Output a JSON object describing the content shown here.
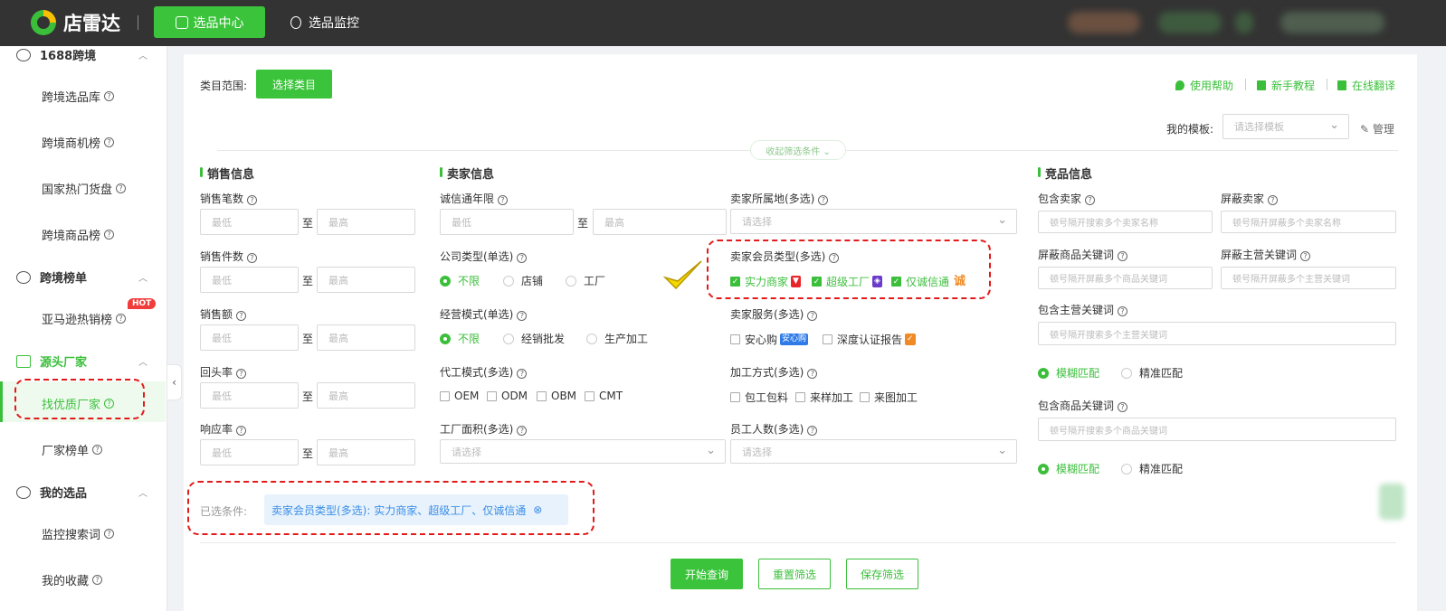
{
  "app": {
    "title": "店雷达"
  },
  "topnav": {
    "active_tab": "选品中心",
    "tab2": "选品监控"
  },
  "sidebar": {
    "sec1": "1688跨境",
    "sec1_items": [
      "跨境选品库",
      "跨境商机榜",
      "国家热门货盘",
      "跨境商品榜"
    ],
    "sec2": "跨境榜单",
    "sec2_items": [
      "亚马逊热销榜"
    ],
    "hot": "HOT",
    "sec3": "源头厂家",
    "sec3_items": [
      "找优质厂家",
      "厂家榜单"
    ],
    "sec4": "我的选品",
    "sec4_items": [
      "监控搜索词",
      "我的收藏"
    ],
    "collapse": "‹"
  },
  "header": {
    "category_label": "类目范围:",
    "category_btn": "选择类目",
    "help": "使用帮助",
    "tutorial": "新手教程",
    "translate": "在线翻译",
    "template_label": "我的模板:",
    "template_placeholder": "请选择模板",
    "manage": "管理",
    "collapse_filter": "收起筛选条件 ⌄"
  },
  "sales": {
    "title": "销售信息",
    "fields": [
      "销售笔数",
      "销售件数",
      "销售额",
      "回头率",
      "响应率"
    ],
    "min": "最低",
    "max": "最高",
    "to": "至"
  },
  "seller": {
    "title": "卖家信息",
    "years": "诚信通年限",
    "company_type": "公司类型(单选)",
    "company_opts": [
      "不限",
      "店铺",
      "工厂"
    ],
    "biz_mode": "经营模式(单选)",
    "biz_opts": [
      "不限",
      "经销批发",
      "生产加工"
    ],
    "oem_mode": "代工模式(多选)",
    "oem_opts": [
      "OEM",
      "ODM",
      "OBM",
      "CMT"
    ],
    "factory_area": "工厂面积(多选)",
    "location": "卖家所属地(多选)",
    "member_type": "卖家会员类型(多选)",
    "member_opts": [
      "实力商家",
      "超级工厂",
      "仅诚信通"
    ],
    "service": "卖家服务(多选)",
    "service_opts": [
      "安心购",
      "深度认证报告"
    ],
    "service_badge": "安心购",
    "process": "加工方式(多选)",
    "process_opts": [
      "包工包料",
      "来样加工",
      "来图加工"
    ],
    "staff": "员工人数(多选)",
    "select_placeholder": "请选择"
  },
  "compete": {
    "title": "竞品信息",
    "include_seller": "包含卖家",
    "include_seller_ph": "顿号隔开搜索多个卖家名称",
    "block_seller": "屏蔽卖家",
    "block_seller_ph": "顿号隔开屏蔽多个卖家名称",
    "block_goods_kw": "屏蔽商品关键词",
    "block_goods_ph": "顿号隔开屏蔽多个商品关键词",
    "block_main_kw": "屏蔽主营关键词",
    "block_main_ph": "顿号隔开屏蔽多个主营关键词",
    "include_main_kw": "包含主营关键词",
    "include_main_ph": "顿号隔开搜索多个主营关键词",
    "fuzzy": "模糊匹配",
    "exact": "精准匹配",
    "include_goods_kw": "包含商品关键词",
    "include_goods_ph": "顿号隔开搜索多个商品关键词"
  },
  "selected": {
    "label": "已选条件:",
    "tag": "卖家会员类型(多选):  实力商家、超级工厂、仅诚信通",
    "tag_close": "⊗"
  },
  "actions": {
    "search": "开始查询",
    "reset": "重置筛选",
    "save": "保存筛选"
  },
  "colors": {
    "brand": "#3bbf3b",
    "annotation": "#e21a1a",
    "topbar": "#333333"
  }
}
